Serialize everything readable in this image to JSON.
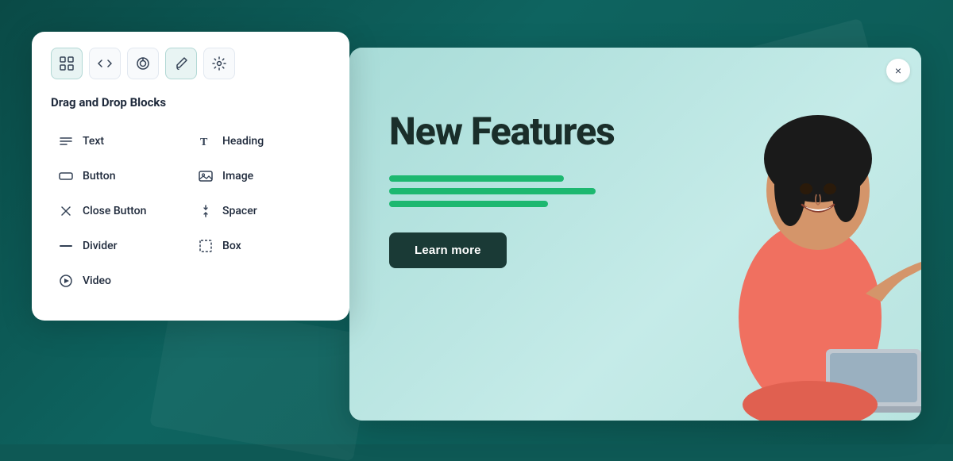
{
  "background": {
    "color": "#0e5955"
  },
  "panel": {
    "title": "Drag and Drop Blocks",
    "toolbar": [
      {
        "name": "grid-icon",
        "label": "Grid",
        "active": true,
        "unicode": "⊞"
      },
      {
        "name": "code-icon",
        "label": "Code",
        "active": false,
        "unicode": "<>"
      },
      {
        "name": "layers-icon",
        "label": "Layers",
        "active": false,
        "unicode": "⊕"
      },
      {
        "name": "brush-icon",
        "label": "Brush",
        "active": true,
        "unicode": "✏"
      },
      {
        "name": "settings-icon",
        "label": "Settings",
        "active": false,
        "unicode": "⚙"
      }
    ],
    "blocks": [
      {
        "id": "text",
        "label": "Text",
        "icon": "text-icon"
      },
      {
        "id": "heading",
        "label": "Heading",
        "icon": "heading-icon"
      },
      {
        "id": "button",
        "label": "Button",
        "icon": "button-icon"
      },
      {
        "id": "image",
        "label": "Image",
        "icon": "image-icon"
      },
      {
        "id": "close-button",
        "label": "Close Button",
        "icon": "close-icon"
      },
      {
        "id": "spacer",
        "label": "Spacer",
        "icon": "spacer-icon"
      },
      {
        "id": "divider",
        "label": "Divider",
        "icon": "divider-icon"
      },
      {
        "id": "box",
        "label": "Box",
        "icon": "box-icon"
      },
      {
        "id": "video",
        "label": "Video",
        "icon": "video-icon"
      }
    ]
  },
  "preview": {
    "heading": "New Features",
    "lines": [
      220,
      260,
      200
    ],
    "button_label": "Learn more",
    "close_label": "×"
  }
}
